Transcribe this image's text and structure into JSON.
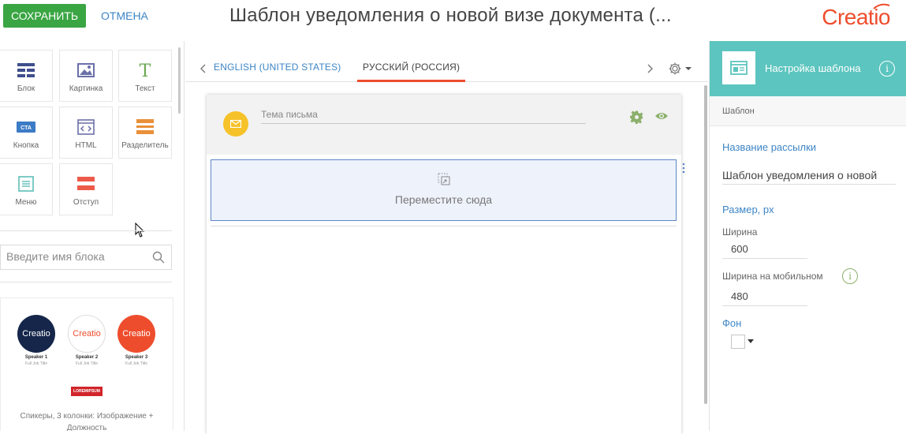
{
  "header": {
    "save_label": "СОХРАНИТЬ",
    "cancel_label": "ОТМЕНА",
    "title": "Шаблон уведомления о новой визе документа (...",
    "logo_text": "Creatio"
  },
  "blocks": [
    {
      "label": "Блок",
      "icon": "block-grid-icon"
    },
    {
      "label": "Картинка",
      "icon": "image-icon"
    },
    {
      "label": "Текст",
      "icon": "text-t-icon"
    },
    {
      "label": "Кнопка",
      "icon": "cta-button-icon",
      "icon_text": "CTA"
    },
    {
      "label": "HTML",
      "icon": "html-code-icon"
    },
    {
      "label": "Разделитель",
      "icon": "divider-icon"
    },
    {
      "label": "Меню",
      "icon": "menu-icon"
    },
    {
      "label": "Отступ",
      "icon": "spacer-icon"
    }
  ],
  "block_search": {
    "placeholder": "Введите имя блока"
  },
  "preview": {
    "speakers": [
      {
        "logo": "Creatio",
        "name": "Speaker 1",
        "subtitle": "Full Job Title"
      },
      {
        "logo": "Creatio",
        "name": "Speaker 2",
        "subtitle": "Full Job Title"
      },
      {
        "logo": "Creatio",
        "name": "Speaker 3",
        "subtitle": "Full Job Title"
      }
    ],
    "badge": "LOREMIPSUM",
    "caption": "Спикеры, 3 колонки: Изображение + Должность"
  },
  "languages": {
    "tabs": [
      "ENGLISH (UNITED STATES)",
      "РУССКИЙ (РОССИЯ)"
    ],
    "active_index": 1
  },
  "editor": {
    "subject_placeholder": "Тема письма",
    "drop_text": "Переместите сюда"
  },
  "settings": {
    "header": "Настройка шаблона",
    "section": "Шаблон",
    "mailing_name_label": "Название рассылки",
    "mailing_name_value": "Шаблон уведомления о новой",
    "size_label": "Размер, px",
    "width_label": "Ширина",
    "width_value": "600",
    "mobile_width_label": "Ширина на мобильном",
    "mobile_width_value": "480",
    "background_label": "Фон",
    "background_color": "#ffffff"
  },
  "colors": {
    "save_green": "#3aa543",
    "link_blue": "#3c85c6",
    "brand_red": "#ee4d2d",
    "panel_teal": "#5dc5bf",
    "badge_yellow": "#f6c229",
    "icon_green": "#8cb06b"
  }
}
